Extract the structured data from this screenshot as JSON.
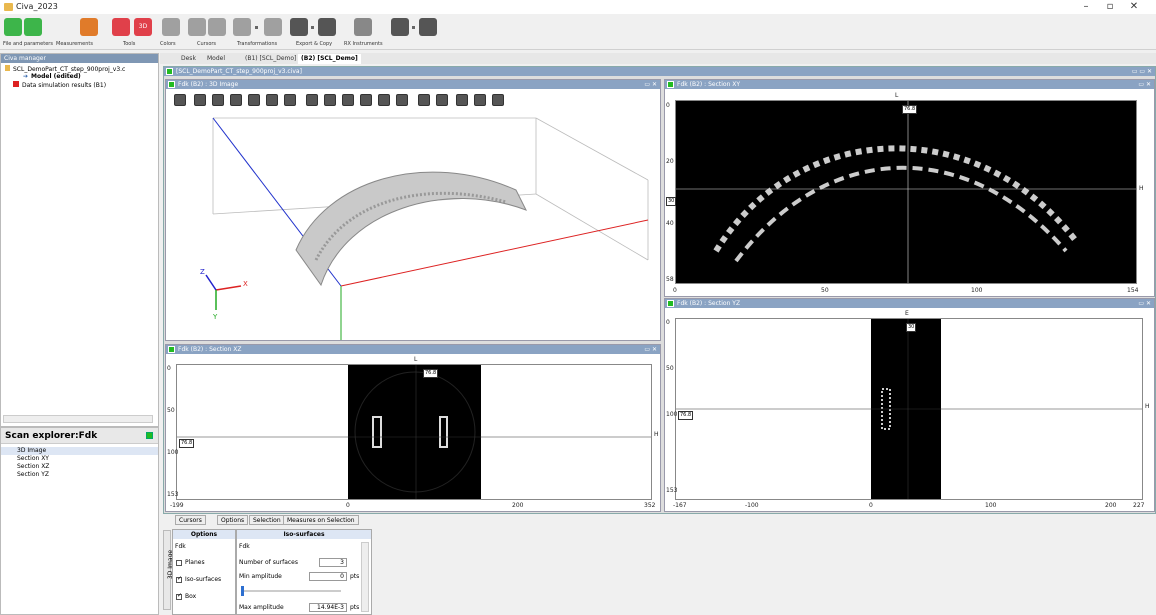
{
  "window": {
    "title": "Civa_2023"
  },
  "toolbar": {
    "groups": [
      {
        "label": "File and parameters",
        "color": "#3db54a"
      },
      {
        "label": "Measurements",
        "color": "#e07b2a"
      },
      {
        "label": "Tools",
        "color": "#e0404a"
      },
      {
        "label": "Colors",
        "color": "#999999"
      },
      {
        "label": "Cursors",
        "color": "#999999"
      },
      {
        "label": "Transformations",
        "color": "#999999"
      },
      {
        "label": "Export & Copy",
        "color": "#555555"
      },
      {
        "label": "RX Instruments",
        "color": "#777777"
      }
    ],
    "badge_3d": "3D"
  },
  "manager": {
    "title": "Civa manager",
    "items": [
      {
        "label": "SCL_DemoPart_CT_step_900proj_v3.c"
      },
      {
        "label": "Model (edited)"
      },
      {
        "label": "Data simulation results (B1)"
      }
    ]
  },
  "scan_explorer": {
    "title": "Scan explorer:Fdk",
    "items": [
      {
        "label": "3D Image"
      },
      {
        "label": "Section XY"
      },
      {
        "label": "Section XZ"
      },
      {
        "label": "Section YZ"
      }
    ]
  },
  "dock_tabs": [
    {
      "label": "Desk"
    },
    {
      "label": "Model"
    },
    {
      "label": "(B1) [SCL_Demo]"
    },
    {
      "label": "(B2) [SCL_Demo]"
    }
  ],
  "outer_title": "[SCL_DemoPart_CT_step_900proj_v3.civa]",
  "view3d": {
    "title": "Fdk (B2) : 3D Image",
    "axes": {
      "z": "Z",
      "x": "X",
      "y": "Y"
    }
  },
  "section_xy": {
    "title": "Fdk (B2) : Section XY",
    "cursor_top_letter": "L",
    "cursor_top_value": "76.8",
    "cursor_left_value": "30",
    "right_letter": "H",
    "x_ticks": [
      "0",
      "50",
      "100",
      "154"
    ],
    "y_ticks": [
      "0",
      "20",
      "40",
      "58"
    ]
  },
  "section_xz": {
    "title": "Fdk (B2) : Section XZ",
    "cursor_top_letter": "L",
    "cursor_top_value": "76.8",
    "cursor_left_value": "76.8",
    "right_letter": "H",
    "x_ticks": [
      "-199",
      "0",
      "200",
      "352"
    ],
    "y_ticks": [
      "0",
      "50",
      "100",
      "153"
    ]
  },
  "section_yz": {
    "title": "Fdk (B2) : Section YZ",
    "cursor_top_letter": "E",
    "cursor_top_value": "30",
    "cursor_left_value": "76.8",
    "right_letter": "H",
    "x_ticks": [
      "-167",
      "-100",
      "0",
      "100",
      "200",
      "227"
    ],
    "y_ticks": [
      "0",
      "50",
      "100",
      "153"
    ]
  },
  "bottom_tabs": [
    {
      "label": "Cursors"
    },
    {
      "label": "Options"
    },
    {
      "label": "Selection"
    },
    {
      "label": "Measures on Selection"
    }
  ],
  "side_tab": "3D Image",
  "options": {
    "title": "Options",
    "group": "Fdk",
    "planes": {
      "label": "Planes",
      "checked": false
    },
    "iso": {
      "label": "Iso-surfaces",
      "checked": true
    },
    "box": {
      "label": "Box",
      "checked": true
    }
  },
  "iso_surfaces": {
    "title": "Iso-surfaces",
    "group": "Fdk",
    "number_label": "Number of surfaces",
    "number_value": "3",
    "min_label": "Min amplitude",
    "min_value": "0",
    "max_label": "Max amplitude",
    "max_value": "14.94E-3",
    "unit": "pts"
  }
}
